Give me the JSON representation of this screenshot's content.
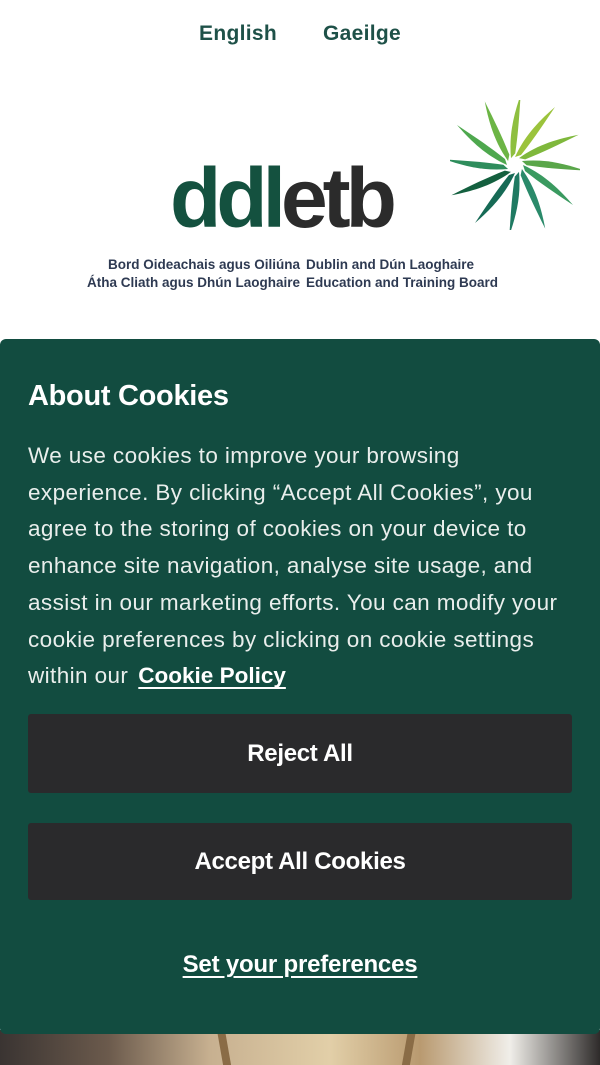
{
  "language_bar": {
    "english": "English",
    "gaeilge": "Gaeilge"
  },
  "logo": {
    "wordmark_dd": "dd",
    "wordmark_l": "l",
    "wordmark_etb": "etb",
    "irish_line1": "Bord Oideachais agus Oiliúna",
    "irish_line2": "Átha Cliath agus Dhún Laoghaire",
    "english_line1": "Dublin and Dún Laoghaire",
    "english_line2": "Education and Training Board"
  },
  "cookie_banner": {
    "title": "About Cookies",
    "body": "We use cookies to improve your browsing experience. By clicking “Accept All Cookies”, you agree to the storing of cookies on your device to enhance site navigation, analyse site usage, and assist in our marketing efforts. You can modify your cookie preferences by clicking on cookie settings within our",
    "policy_link": "Cookie Policy",
    "reject_label": "Reject All",
    "accept_label": "Accept All Cookies",
    "preferences_label": "Set your preferences"
  },
  "colors": {
    "panel_bg": "#124c40",
    "button_bg": "#2a2a2c",
    "lang_text": "#1e5148",
    "logo_green": "#14513f",
    "logo_lime": "#9bc33c"
  }
}
